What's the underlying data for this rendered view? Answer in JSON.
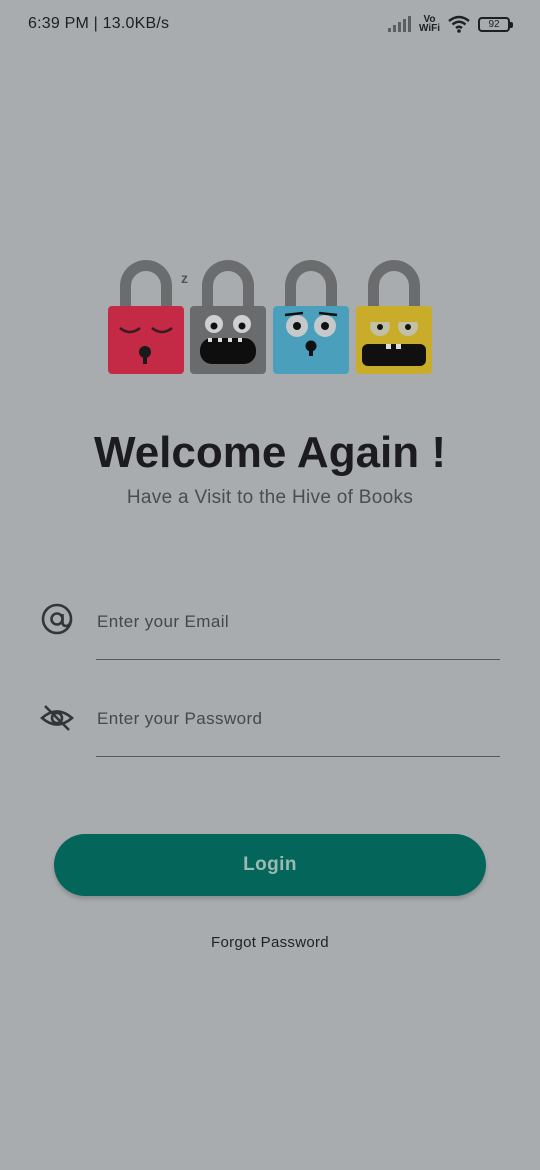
{
  "status_bar": {
    "time_speed": "6:39 PM | 13.0KB/s",
    "vowifi_top": "Vo",
    "vowifi_bottom": "WiFi",
    "battery": "92",
    "icons": [
      "signal-icon",
      "vowifi-icon",
      "wifi-icon",
      "battery-icon"
    ]
  },
  "logo": {
    "locks": [
      {
        "name": "red-lock",
        "color": "#c42a45"
      },
      {
        "name": "gray-lock",
        "color": "#6a6b6d"
      },
      {
        "name": "blue-lock",
        "color": "#4a9fbd"
      },
      {
        "name": "yellow-lock",
        "color": "#c9ad2a"
      }
    ],
    "sleep_mark": "z"
  },
  "welcome": {
    "title": "Welcome Again !",
    "subtitle": "Have a Visit to the Hive of Books"
  },
  "form": {
    "email_placeholder": "Enter your Email",
    "password_placeholder": "Enter your Password",
    "email_icon": "at-icon",
    "password_icon": "eye-off-icon"
  },
  "actions": {
    "login_label": "Login",
    "forgot_label": "Forgot Password"
  },
  "colors": {
    "background": "#a9acaf",
    "accent": "#04665a"
  }
}
